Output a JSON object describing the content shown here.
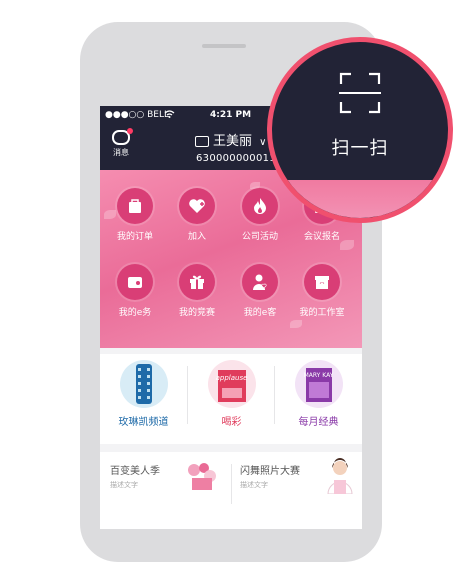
{
  "status_bar": {
    "carrier": "●●●○○ BELL",
    "time": "4:21 PM"
  },
  "header": {
    "messages_label": "消息",
    "user_name": "王美丽",
    "user_id": "630000000011"
  },
  "menu": [
    {
      "label": "我的订单",
      "icon": "bag-icon"
    },
    {
      "label": "加入",
      "icon": "heart-plus-icon"
    },
    {
      "label": "公司活动",
      "icon": "flame-icon"
    },
    {
      "label": "会议报名",
      "icon": "calendar-icon"
    },
    {
      "label": "我的e务",
      "icon": "wallet-icon"
    },
    {
      "label": "我的竞赛",
      "icon": "gift-icon"
    },
    {
      "label": "我的e客",
      "icon": "person-heart-icon"
    },
    {
      "label": "我的工作室",
      "icon": "studio-box-icon"
    }
  ],
  "features": [
    {
      "label": "玫琳凯频道",
      "icon": "film-reel-icon",
      "color": "#1e6aa8"
    },
    {
      "label": "喝彩",
      "icon": "applause-book-icon",
      "color": "#e03c5c"
    },
    {
      "label": "每月经典",
      "icon": "mary-kay-book-icon",
      "color": "#8a3aa8",
      "book_text": "MARY KAY"
    }
  ],
  "applause_book_text": "applause",
  "banners": [
    {
      "title": "百变美人季",
      "subtitle": "描述文字"
    },
    {
      "title": "闪舞照片大赛",
      "subtitle": "描述文字"
    }
  ],
  "scan": {
    "label": "扫一扫",
    "icon": "scan-frame-icon"
  }
}
